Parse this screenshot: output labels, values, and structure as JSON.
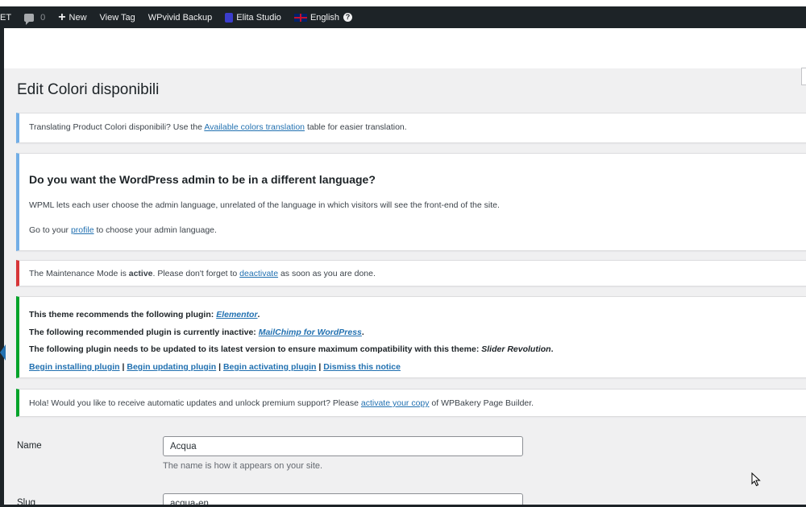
{
  "adminbar": {
    "cut_item": "ET",
    "comments_count": "0",
    "new_label": "New",
    "view_tag": "View Tag",
    "wpvivid": "WPvivid Backup",
    "elita": "Elita Studio",
    "language": "English",
    "icons": [
      "comment-icon",
      "plus-icon",
      "studio-icon",
      "uk-flag-icon",
      "help-icon"
    ]
  },
  "page": {
    "title": "Edit Colori disponibili"
  },
  "notice_translation": {
    "before": "Translating Product Colori disponibili? Use the ",
    "link": "Available colors translation",
    "after": " table for easier translation."
  },
  "notice_wpml": {
    "heading": "Do you want the WordPress admin to be in a different language?",
    "line1": "WPML lets each user choose the admin language, unrelated of the language in which visitors will see the front-end of the site.",
    "line2_before": "Go to your ",
    "line2_link": "profile",
    "line2_after": " to choose your admin language."
  },
  "notice_maintenance": {
    "before": "The Maintenance Mode is ",
    "strong": "active",
    "middle": ". Please don't forget to ",
    "link": "deactivate",
    "after": " as soon as you are done."
  },
  "notice_plugins": {
    "line1_before": "This theme recommends the following plugin: ",
    "line1_link": "Elementor",
    "line1_after": ".",
    "line2_before": "The following recommended plugin is currently inactive: ",
    "line2_link": "MailChimp for WordPress",
    "line2_after": ".",
    "line3_before": "The following plugin needs to be updated to its latest version to ensure maximum compatibility with this theme: ",
    "line3_em": "Slider Revolution",
    "line3_after": ".",
    "action_install": "Begin installing plugin",
    "action_update": "Begin updating plugin",
    "action_activate": "Begin activating plugin",
    "action_dismiss": "Dismiss this notice",
    "separator": " | "
  },
  "notice_wpbakery": {
    "before": "Hola! Would you like to receive automatic updates and unlock premium support? Please ",
    "link": "activate your copy",
    "after": " of WPBakery Page Builder."
  },
  "form": {
    "name_label": "Name",
    "name_value": "Acqua",
    "name_desc": "The name is how it appears on your site.",
    "slug_label": "Slug",
    "slug_value": "acqua-en"
  },
  "colors": {
    "adminbar": "#1d2327",
    "link": "#2271b1",
    "info_border": "#72aee6",
    "error_border": "#d63638",
    "success_border": "#00a32a",
    "content_bg": "#f0f0f1"
  }
}
